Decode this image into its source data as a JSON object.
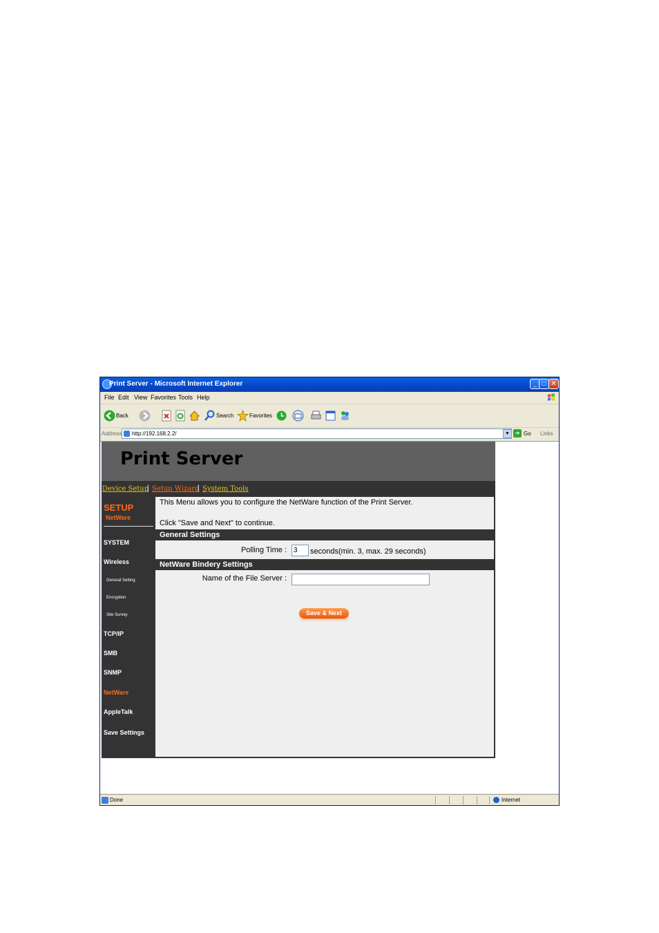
{
  "window": {
    "title": "Print Server - Microsoft Internet Explorer",
    "min_label": "_",
    "max_label": "□",
    "close_label": "✕"
  },
  "menubar": {
    "items": [
      "File",
      "Edit",
      "View",
      "Favorites",
      "Tools",
      "Help"
    ]
  },
  "toolbar": {
    "back_label": "Back",
    "search_label": "Search",
    "favorites_label": "Favorites"
  },
  "addressbar": {
    "label": "Address",
    "url": "http://192.168.2.2/",
    "go_label": "Go",
    "links_label": "Links"
  },
  "page": {
    "banner_title": "Print Server",
    "nav": {
      "device_setup": "Device Setup",
      "setup_wizard": "Setup Wizard",
      "system_tools": "System Tools",
      "sep": "|"
    },
    "sidebar": {
      "title": "SETUP",
      "subtitle": "NetWare",
      "items": [
        "SYSTEM",
        "Wireless",
        "General Setting",
        "Encryption",
        "Site Survey",
        "TCP/IP",
        "SMB",
        "SNMP",
        "NetWare",
        "AppleTalk",
        "Save Settings"
      ],
      "active": "NetWare"
    },
    "intro_line1": "This Menu allows you to configure the NetWare function of the Print Server.",
    "intro_line2": "Click \"Save and Next\" to continue.",
    "general_header": "General Settings",
    "polling_label": "Polling Time :",
    "polling_value": "3",
    "polling_hint": "seconds(min. 3, max. 29 seconds)",
    "bindery_header": "NetWare Bindery Settings",
    "fileserver_label": "Name of the File Server :",
    "fileserver_value": "",
    "save_button": "Save & Next"
  },
  "statusbar": {
    "status": "Done",
    "zone": "Internet"
  },
  "colors": {
    "accent": "#FF6A1A",
    "nav_dark": "#333333",
    "banner": "#606060",
    "title_blue": "#0A5FE0"
  }
}
